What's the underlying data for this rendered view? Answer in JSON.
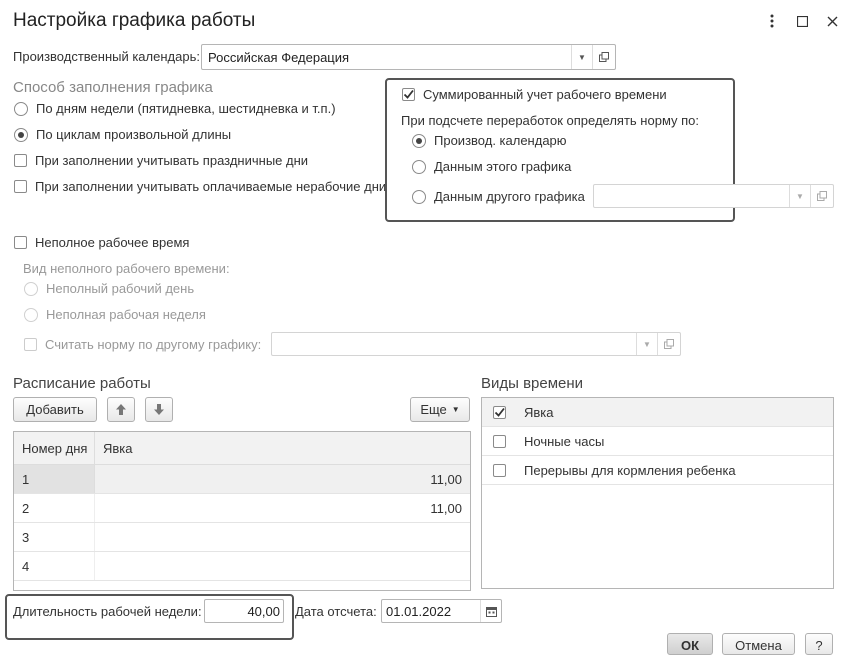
{
  "window": {
    "title": "Настройка графика работы"
  },
  "calendar": {
    "label": "Производственный календарь:",
    "value": "Российская Федерация"
  },
  "fill_method": {
    "heading": "Способ заполнения графика",
    "options": [
      {
        "label": "По дням недели (пятидневка, шестидневка и т.п.)",
        "selected": false
      },
      {
        "label": "По циклам произвольной длины",
        "selected": true
      }
    ],
    "holidays_label": "При заполнении учитывать праздничные дни",
    "paid_nonworking_label": "При заполнении учитывать оплачиваемые нерабочие дни"
  },
  "summary": {
    "checkbox_label": "Суммированный учет рабочего времени",
    "checked": true,
    "norm_heading": "При подсчете переработок определять норму по:",
    "options": [
      {
        "label": "Производ. календарю",
        "selected": true
      },
      {
        "label": "Данным этого графика",
        "selected": false
      },
      {
        "label": "Данным другого графика",
        "selected": false
      }
    ],
    "other_schedule_value": ""
  },
  "parttime": {
    "checkbox_label": "Неполное рабочее время",
    "kind_label": "Вид неполного рабочего времени:",
    "options": [
      {
        "label": "Неполный рабочий день"
      },
      {
        "label": "Неполная рабочая неделя"
      }
    ],
    "other_norm_label": "Считать норму по другому графику:",
    "other_norm_value": ""
  },
  "schedule": {
    "heading": "Расписание работы",
    "add_label": "Добавить",
    "more_label": "Еще",
    "columns": [
      "Номер дня",
      "Явка"
    ],
    "rows": [
      {
        "day": "1",
        "value": "11,00"
      },
      {
        "day": "2",
        "value": "11,00"
      },
      {
        "day": "3",
        "value": ""
      },
      {
        "day": "4",
        "value": ""
      }
    ]
  },
  "time_kinds": {
    "heading": "Виды времени",
    "items": [
      {
        "label": "Явка",
        "checked": true
      },
      {
        "label": "Ночные часы",
        "checked": false
      },
      {
        "label": "Перерывы для кормления ребенка",
        "checked": false
      }
    ]
  },
  "footer": {
    "week_length_label": "Длительность рабочей недели:",
    "week_length_value": "40,00",
    "ref_date_label": "Дата отсчета:",
    "ref_date_value": "01.01.2022",
    "ok_label": "ОК",
    "cancel_label": "Отмена",
    "help_label": "?"
  }
}
